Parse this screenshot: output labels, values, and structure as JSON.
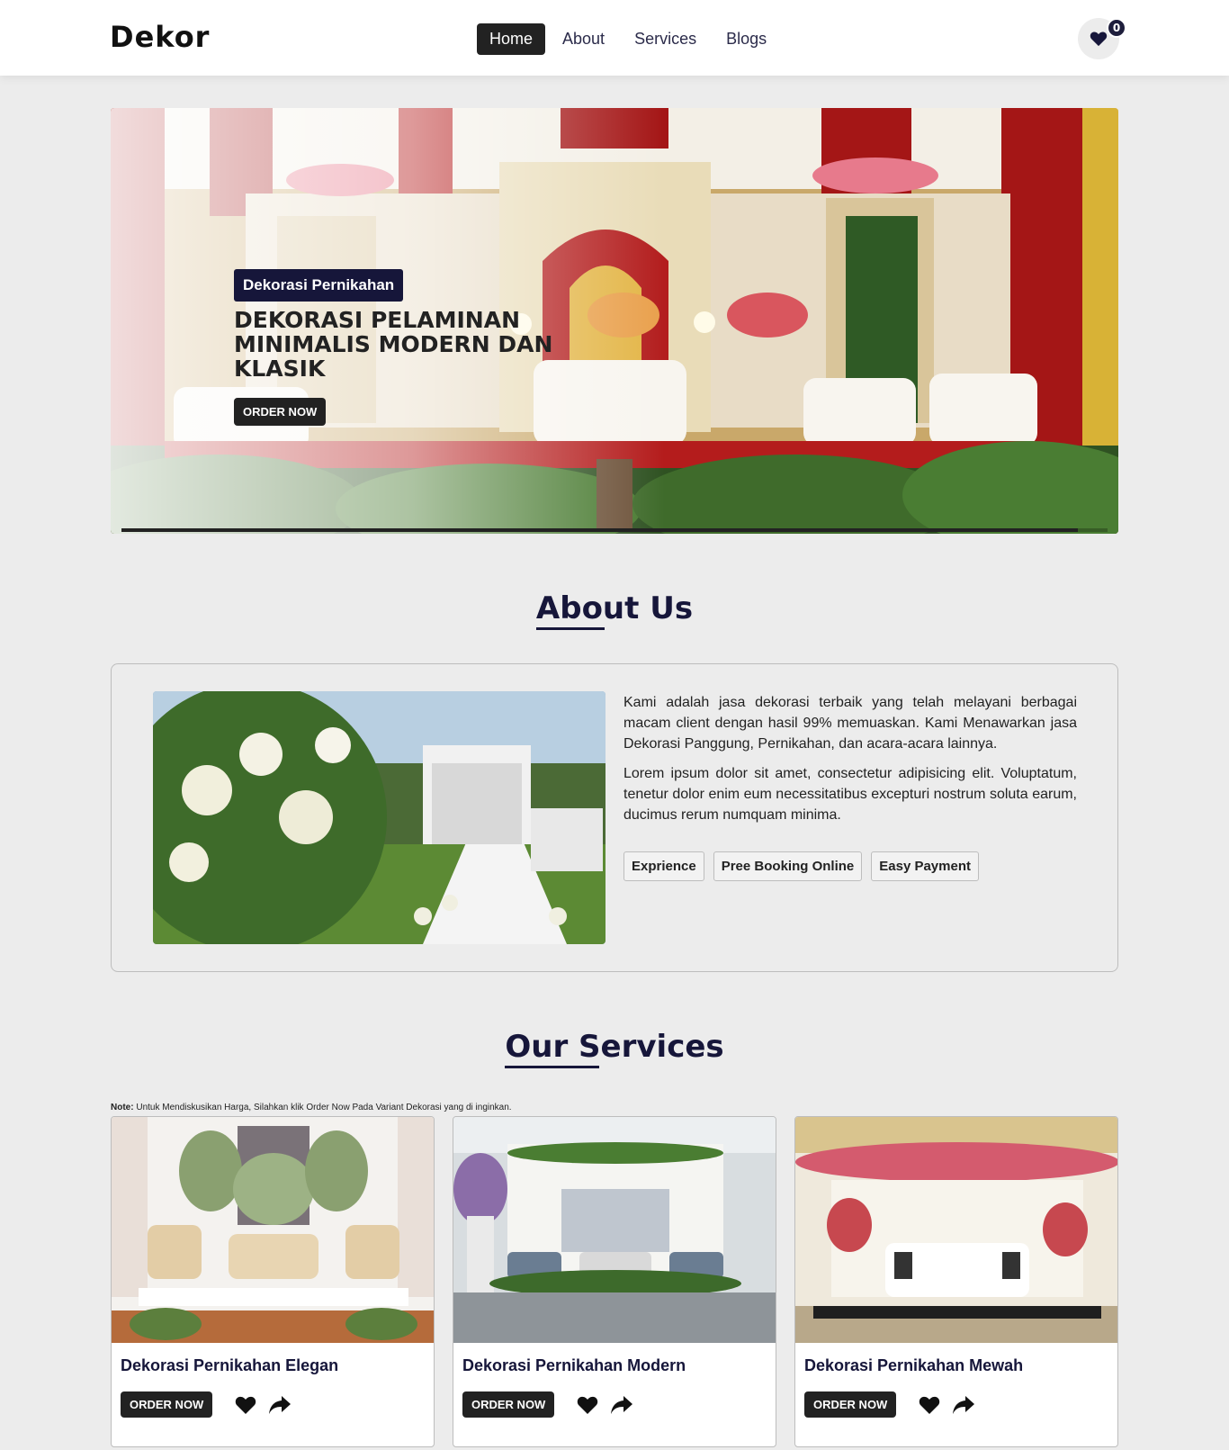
{
  "navbar": {
    "brand": "Dekor",
    "links": [
      {
        "label": "Home",
        "active": true
      },
      {
        "label": "About",
        "active": false
      },
      {
        "label": "Services",
        "active": false
      },
      {
        "label": "Blogs",
        "active": false
      }
    ],
    "favorites_count": "0",
    "icon": "heart-icon"
  },
  "hero": {
    "tag": "Dekorasi Pernikahan",
    "title": "DEKORASI PELAMINAN MINIMALIS MODERN DAN KLASIK",
    "button": "ORDER NOW",
    "progress": 0.97
  },
  "about": {
    "title": "About Us",
    "paragraph1": "Kami adalah jasa dekorasi terbaik yang telah melayani berbagai macam client dengan hasil 99% memuaskan. Kami Menawarkan jasa Dekorasi Panggung, Pernikahan, dan acara-acara lainnya.",
    "paragraph2": "Lorem ipsum dolor sit amet, consectetur adipisicing elit. Voluptatum, tenetur dolor enim eum necessitatibus excepturi nostrum soluta earum, ducimus rerum numquam minima.",
    "chips": [
      "Exprience",
      "Pree Booking Online",
      "Easy Payment"
    ]
  },
  "services": {
    "title": "Our Services",
    "note_label": "Note:",
    "note_text": " Untuk Mendiskusikan Harga, Silahkan klik Order Now Pada Variant Dekorasi yang di inginkan.",
    "cards": [
      {
        "title": "Dekorasi Pernikahan Elegan",
        "button": "ORDER NOW"
      },
      {
        "title": "Dekorasi Pernikahan Modern",
        "button": "ORDER NOW"
      },
      {
        "title": "Dekorasi Pernikahan Mewah",
        "button": "ORDER NOW"
      }
    ],
    "icons": [
      "heart-icon",
      "share-icon"
    ]
  },
  "colors": {
    "accent": "#16163a",
    "dark": "#222222",
    "background": "#ececec"
  }
}
